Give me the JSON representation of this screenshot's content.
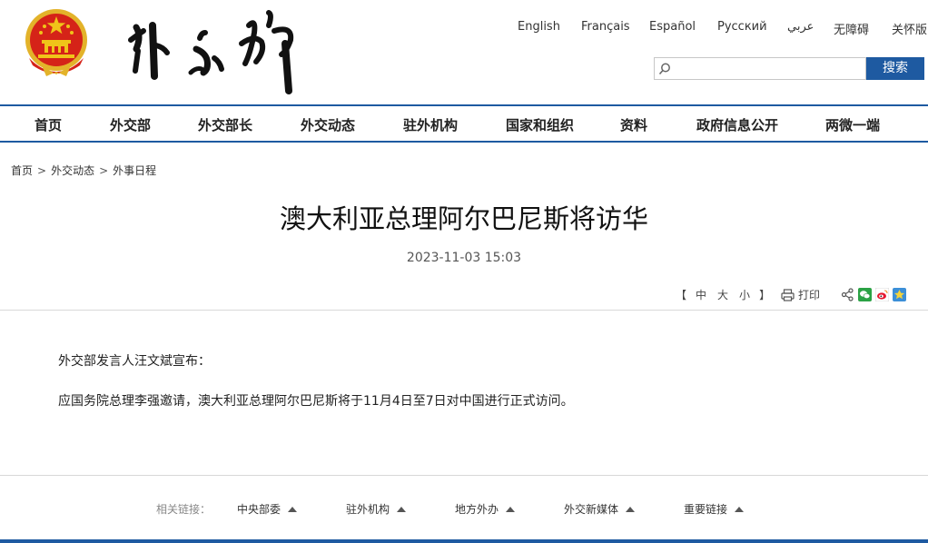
{
  "header": {
    "languages": [
      "English",
      "Français",
      "Español",
      "Русский",
      "عربي",
      "无障碍",
      "关怀版"
    ],
    "search": {
      "placeholder": "",
      "button_label": "搜索"
    }
  },
  "nav": {
    "items": [
      "首页",
      "外交部",
      "外交部长",
      "外交动态",
      "驻外机构",
      "国家和组织",
      "资料",
      "政府信息公开",
      "两微一端"
    ]
  },
  "breadcrumb": [
    "首页",
    "外交动态",
    "外事日程"
  ],
  "article": {
    "title": "澳大利亚总理阿尔巴尼斯将访华",
    "date": "2023-11-03 15:03",
    "font_open": "【",
    "font_options": [
      "中",
      "大",
      "小"
    ],
    "font_close": "】",
    "print_label": "打印",
    "paragraphs": [
      "外交部发言人汪文斌宣布：",
      "应国务院总理李强邀请，澳大利亚总理阿尔巴尼斯将于11月4日至7日对中国进行正式访问。"
    ]
  },
  "share": {
    "icons": [
      "share-icon",
      "wechat-icon",
      "weibo-icon",
      "favorite-icon"
    ]
  },
  "footer": {
    "label": "相关链接：",
    "links": [
      "中央部委",
      "驻外机构",
      "地方外办",
      "外交新媒体",
      "重要链接"
    ]
  },
  "colors": {
    "brand_blue": "#1e5aa1",
    "emblem_red": "#d52318",
    "emblem_gold": "#f0c419"
  }
}
